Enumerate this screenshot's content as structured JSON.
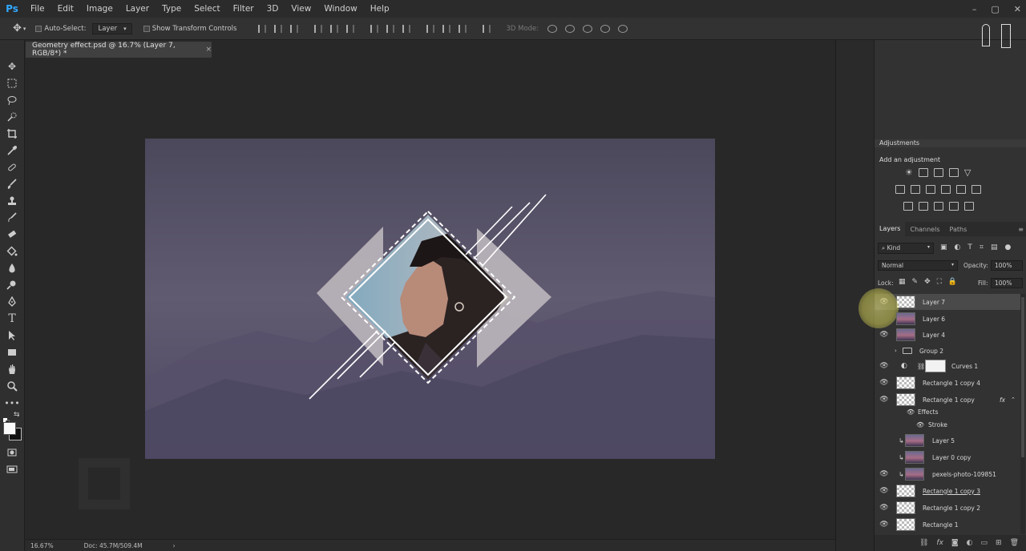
{
  "app": {
    "logo": "Ps"
  },
  "menu": [
    "File",
    "Edit",
    "Image",
    "Layer",
    "Type",
    "Select",
    "Filter",
    "3D",
    "View",
    "Window",
    "Help"
  ],
  "window_controls": {
    "minimize": "–",
    "restore": "▢",
    "close": "✕"
  },
  "options": {
    "auto_select_label": "Auto-Select:",
    "auto_select_value": "Layer",
    "transform_label": "Show Transform Controls",
    "mode_3d_label": "3D Mode:"
  },
  "document": {
    "tab_title": "Geometry effect.psd @ 16.7% (Layer 7, RGB/8*) *",
    "tab_close": "×"
  },
  "status": {
    "zoom": "16.67%",
    "doc_size": "Doc: 45.7M/509.4M",
    "arrow": "›"
  },
  "adjustments": {
    "tab": "Adjustments",
    "hint": "Add an adjustment"
  },
  "layers_panel": {
    "tabs": [
      "Layers",
      "Channels",
      "Paths"
    ],
    "filter_kind": "Kind",
    "blend_mode": "Normal",
    "opacity_label": "Opacity:",
    "opacity_value": "100%",
    "lock_label": "Lock:",
    "fill_label": "Fill:",
    "fill_value": "100%",
    "layers": [
      {
        "name": "Layer 7",
        "visible": true
      },
      {
        "name": "Layer 6",
        "visible": false
      },
      {
        "name": "Layer 4",
        "visible": true
      },
      {
        "name": "Group 2",
        "visible": false
      },
      {
        "name": "Curves 1",
        "visible": true
      },
      {
        "name": "Rectangle 1 copy 4",
        "visible": true
      },
      {
        "name": "Rectangle 1 copy",
        "visible": true,
        "fx": "fx"
      },
      {
        "name": "Effects",
        "visible": true
      },
      {
        "name": "Stroke",
        "visible": true
      },
      {
        "name": "Layer 5",
        "visible": false
      },
      {
        "name": "Layer 0 copy",
        "visible": false
      },
      {
        "name": "pexels-photo-109851",
        "visible": true
      },
      {
        "name": "Rectangle 1 copy 3",
        "visible": true
      },
      {
        "name": "Rectangle 1 copy 2",
        "visible": true
      },
      {
        "name": "Rectangle 1",
        "visible": true
      }
    ],
    "footer_fx": "fx"
  },
  "colors": {
    "accent": "#31a8ff",
    "panel": "#323232",
    "canvas_bg": "#282828"
  }
}
